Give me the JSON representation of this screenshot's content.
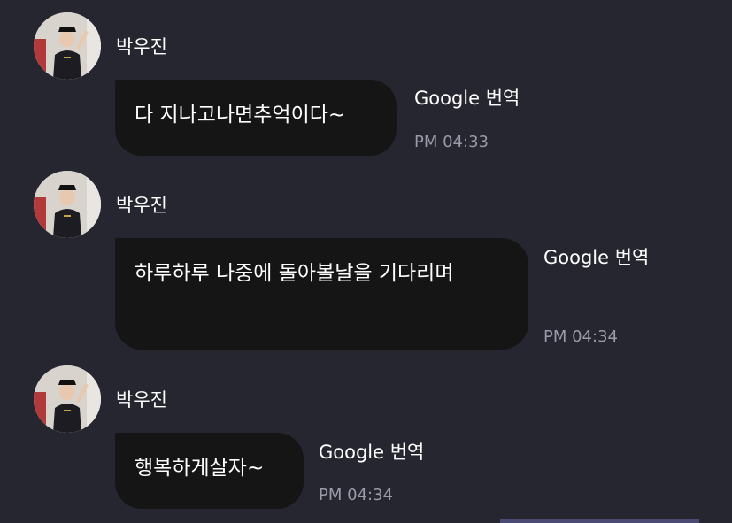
{
  "colors": {
    "background": "#262630",
    "bubble": "#151515",
    "text": "#ffffff",
    "timestamp": "#9a9aa8"
  },
  "messages": [
    {
      "sender": "박우진",
      "avatar_icon": "profile-photo-icon",
      "text": "다 지나고나면추억이다~",
      "translate_label": "Google 번역",
      "time": "PM 04:33"
    },
    {
      "sender": "박우진",
      "avatar_icon": "profile-photo-icon",
      "text": "하루하루 나중에 돌아볼날을 기다리며",
      "translate_label": "Google 번역",
      "time": "PM 04:34"
    },
    {
      "sender": "박우진",
      "avatar_icon": "profile-photo-icon",
      "text": "행복하게살자~",
      "translate_label": "Google 번역",
      "time": "PM 04:34"
    }
  ]
}
